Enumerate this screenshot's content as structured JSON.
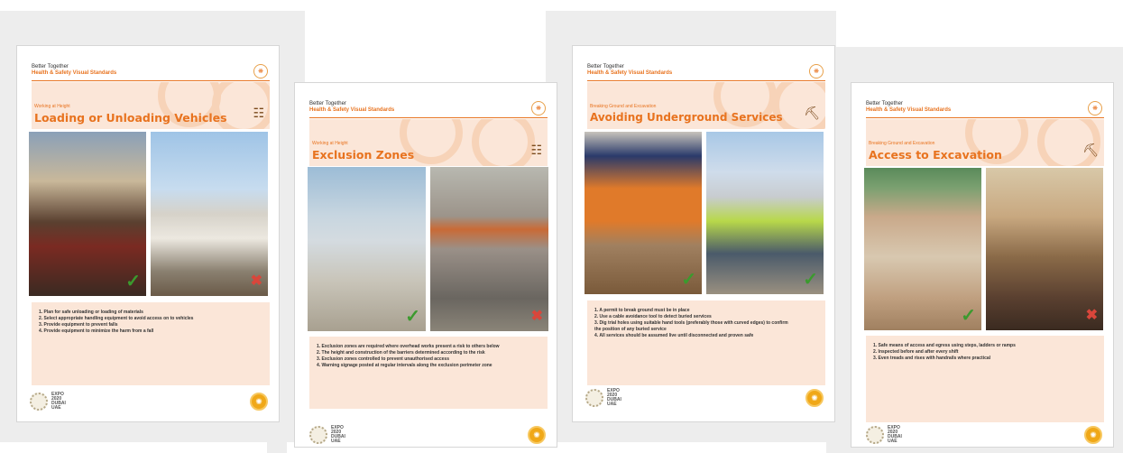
{
  "common": {
    "header_line1": "Better Together",
    "header_line2": "Health & Safety Visual Standards",
    "footer_line1": "EXPO",
    "footer_line2": "2020",
    "footer_line3": "DUBAI",
    "footer_line4": "UAE"
  },
  "posters": [
    {
      "category": "Working at Height",
      "title": "Loading or Unloading Vehicles",
      "icon": "scaffold-icon",
      "rules": [
        "1.  Plan for safe unloading or loading of materials",
        "2.  Select appropriate handling equipment to avoid access on to vehicles",
        "3.  Provide equipment to prevent falls",
        "4.  Provide equipment to minimize the harm from a fall"
      ]
    },
    {
      "category": "Working at Height",
      "title": "Exclusion Zones",
      "icon": "scaffold-icon",
      "rules": [
        "1.  Exclusion zones are required where overhead works present a risk to others below",
        "2.  The height and construction of the barriers determined according to the risk",
        "3.  Exclusion zones controlled to prevent unauthorised access",
        "4.  Warning signage posted at regular intervals along the exclusion perimeter zone"
      ]
    },
    {
      "category": "Breaking Ground and Excavation",
      "title": "Avoiding Underground Services",
      "icon": "excavator-icon",
      "rules": [
        "1.  A permit to break ground must be in place",
        "2.  Use a cable avoidance tool to detect buried services",
        "3.  Dig trial holes using suitable hand tools (preferably those with curved edges) to confirm",
        "     the position of any buried service",
        "4.  All services should be assumed live until disconnected and proven safe"
      ]
    },
    {
      "category": "Breaking Ground and Excavation",
      "title": "Access to Excavation",
      "icon": "excavator-icon",
      "rules": [
        "1.  Safe means of access and egress using steps, ladders or ramps",
        "2.  Inspected before and after every shift",
        "3.  Even treads and rises with handrails where practical"
      ]
    }
  ]
}
